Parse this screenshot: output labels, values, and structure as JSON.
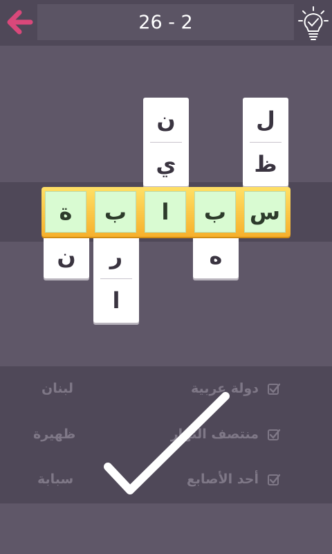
{
  "header": {
    "level": "26 - 2",
    "back_icon": "arrow-left-icon",
    "hint_icon": "lightbulb-check-icon"
  },
  "colors": {
    "background": "#5f5768",
    "band": "#4f4858",
    "back_arrow": "#d9487a",
    "answer_bar": "#f6b02c",
    "answer_slot": "#d9fbd2"
  },
  "board": {
    "answer_row": [
      "س",
      "ب",
      "ا",
      "ب",
      "ة"
    ],
    "columns": {
      "col1_above": [
        "ل",
        "ظ"
      ],
      "col3_above": [
        "ن",
        "ي"
      ],
      "col2_below": [
        "ه"
      ],
      "col4_below": [
        "ر",
        "ا"
      ],
      "col5_below": [
        "ن"
      ]
    }
  },
  "clues": [
    {
      "question": "دولة عربية",
      "answer": "لبنان"
    },
    {
      "question": "منتصف النهار",
      "answer": "ظهيرة"
    },
    {
      "question": "أحد الأصابع",
      "answer": "سبابة"
    }
  ]
}
